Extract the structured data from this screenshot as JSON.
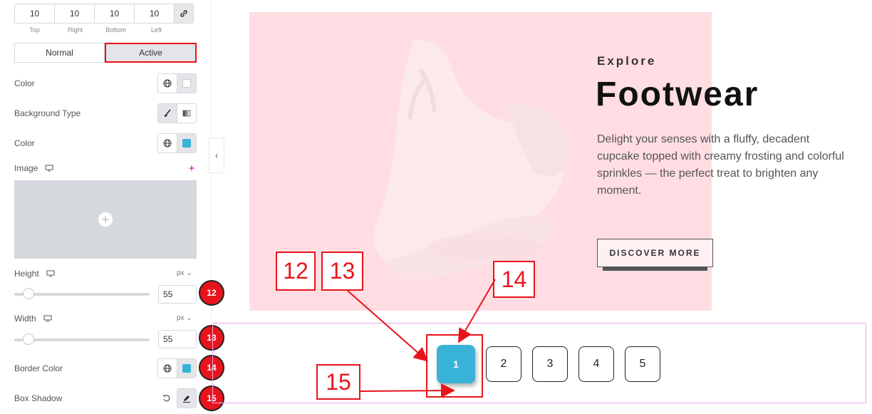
{
  "panel": {
    "dimensions": {
      "values": [
        "10",
        "10",
        "10",
        "10"
      ],
      "labels": [
        "Top",
        "Right",
        "Bottom",
        "Left"
      ]
    },
    "tabs": {
      "normal": "Normal",
      "active": "Active"
    },
    "color_label": "Color",
    "background_type_label": "Background Type",
    "bg_color_label": "Color",
    "image_label": "Image",
    "height": {
      "label": "Height",
      "unit": "px",
      "value": "55"
    },
    "width": {
      "label": "Width",
      "unit": "px",
      "value": "55"
    },
    "border_color_label": "Border Color",
    "box_shadow_label": "Box Shadow",
    "colors": {
      "active_swatch": "#38b2d6",
      "white_swatch": "#ffffff"
    }
  },
  "badges": [
    "12",
    "13",
    "14",
    "15"
  ],
  "banner": {
    "eyebrow": "Explore",
    "headline": "Footwear",
    "description": "Delight your senses with a fluffy, decadent cupcake topped with creamy frosting and colorful sprinkles — the perfect treat to brighten any moment.",
    "cta": "DISCOVER MORE",
    "background": "#ffdde2"
  },
  "pagination": {
    "pages": [
      "1",
      "2",
      "3",
      "4",
      "5"
    ],
    "active_color": "#38b2d6"
  },
  "callouts": [
    "12",
    "13",
    "14",
    "15"
  ],
  "accent": "#e8141b"
}
